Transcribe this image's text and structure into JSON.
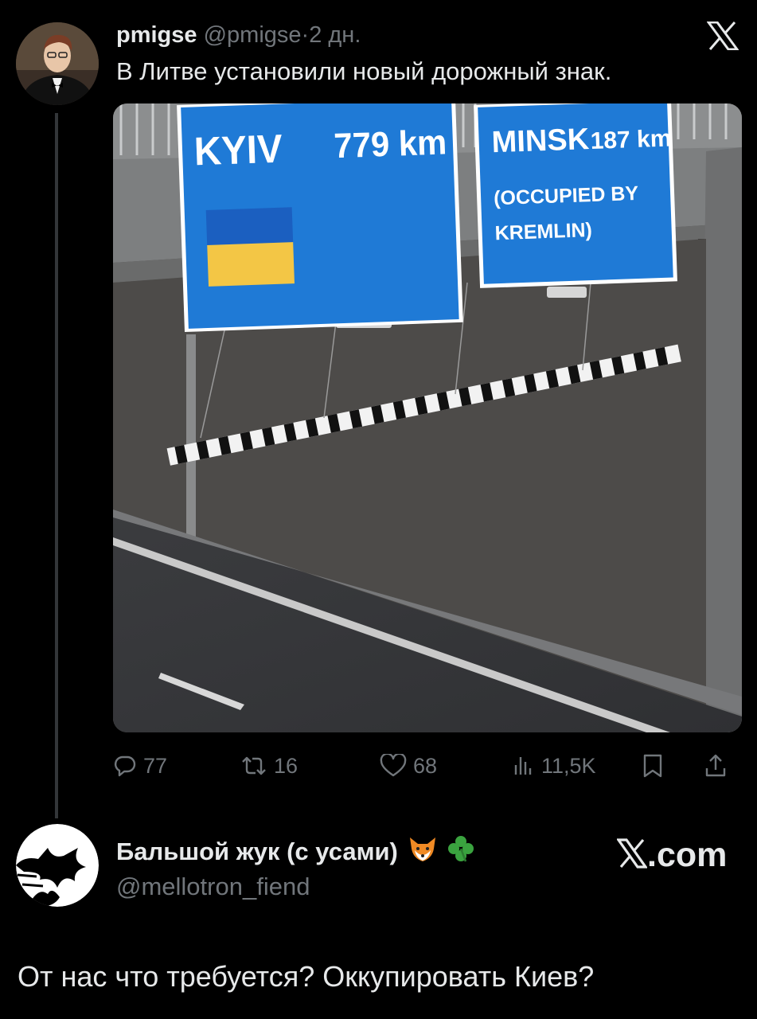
{
  "tweet": {
    "author_name": "pmigse",
    "author_handle": "@pmigse",
    "separator": "·",
    "time": "2 дн.",
    "text": "В Литве установили новый дорожный знак.",
    "media": {
      "sign_left": {
        "city": "KYIV",
        "distance": "779 km"
      },
      "sign_right": {
        "city": "MINSK",
        "distance": "187 km",
        "note_line1": "(OCCUPIED BY",
        "note_line2": "KREMLIN)"
      },
      "colors": {
        "sign_blue": "#1f7ad6",
        "flag_blue": "#1b5fc0",
        "flag_yellow": "#f3c645"
      }
    },
    "stats": {
      "replies": "77",
      "reposts": "16",
      "likes": "68",
      "views": "11,5K"
    }
  },
  "reply": {
    "author_name": "Бальшой жук (с усами)",
    "author_handle": "@mellotron_fiend",
    "brand": ".com",
    "text": "От нас что требуется? Оккупировать Киев?"
  },
  "icons": [
    "x-logo-icon",
    "reply-icon",
    "repost-icon",
    "like-icon",
    "views-icon",
    "bookmark-icon",
    "share-icon",
    "fox-emoji-icon",
    "clover-emoji-icon"
  ]
}
